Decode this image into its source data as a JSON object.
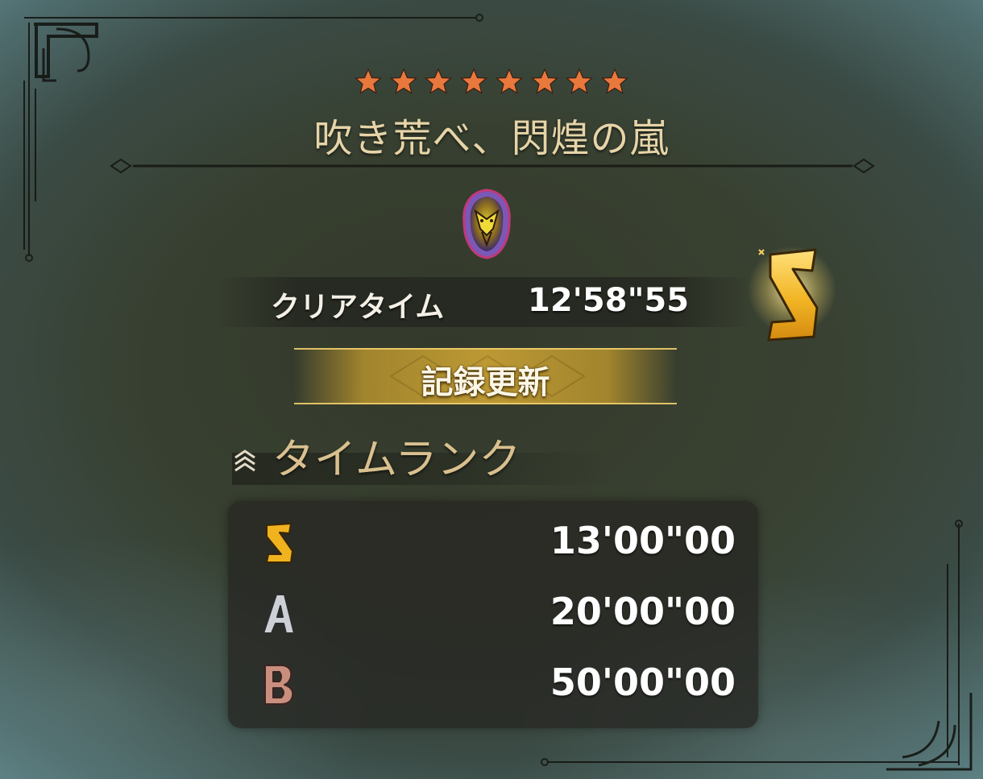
{
  "quest": {
    "star_count": 8,
    "star_color": "#e9783d",
    "title": "吹き荒べ、閃煌の嵐"
  },
  "result": {
    "clear_label": "クリアタイム",
    "clear_time": "12'58\"55",
    "achieved_rank": "S",
    "record_label": "記録更新"
  },
  "time_rank": {
    "section_title": "タイムランク",
    "ranks": [
      {
        "rank": "S",
        "time": "13'00\"00",
        "color": "#f0b21e"
      },
      {
        "rank": "A",
        "time": "20'00\"00",
        "color": "#c9ccd0"
      },
      {
        "rank": "B",
        "time": "50'00\"00",
        "color": "#c98f7e"
      }
    ]
  },
  "colors": {
    "title_gold": "#e6d4a8",
    "record_banner": "#c49e34",
    "rank_gold": "#f0b21e"
  }
}
